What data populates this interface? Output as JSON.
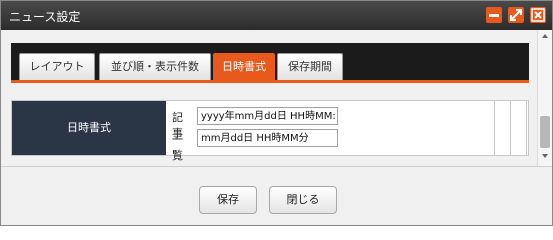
{
  "window": {
    "title": "ニュース設定",
    "accent": "#e85a1c",
    "buttons": [
      "minimize-icon",
      "maximize-icon",
      "close-icon"
    ]
  },
  "tabs": [
    {
      "label": "レイアウト",
      "active": false
    },
    {
      "label": "並び順・表示件数",
      "active": false
    },
    {
      "label": "日時書式",
      "active": true
    },
    {
      "label": "保存期間",
      "active": false
    }
  ],
  "form": {
    "section_label": "日時書式",
    "rows": [
      {
        "label": "記事",
        "value": "yyyy年mm月dd日 HH時MM:"
      },
      {
        "label": "一覧",
        "value": "mm月dd日 HH時MM分"
      }
    ]
  },
  "footer": {
    "save_label": "保存",
    "close_label": "閉じる"
  }
}
